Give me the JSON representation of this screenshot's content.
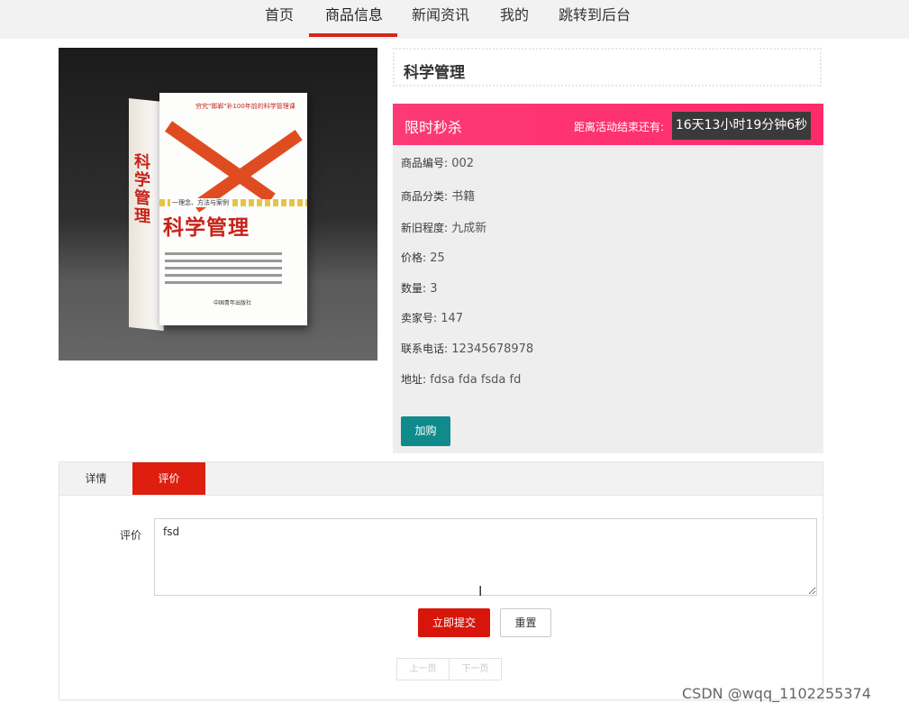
{
  "nav": {
    "items": [
      {
        "label": "首页"
      },
      {
        "label": "商品信息"
      },
      {
        "label": "新闻资讯"
      },
      {
        "label": "我的"
      },
      {
        "label": "跳转到后台"
      }
    ]
  },
  "product": {
    "image": {
      "cover_title": "科学管理",
      "cover_subtitle": "一理念、方法与案例",
      "cover_tagline": "穷究\"邯郸\"补100年前的科学管理课",
      "cover_publisher": "中国青年出版社"
    },
    "title": "科学管理",
    "flash_sale": {
      "label": "限时秒杀",
      "countdown_label": "距离活动结束还有:",
      "countdown": "16天13小时19分钟6秒"
    },
    "info": [
      {
        "key": "商品编号:",
        "value": "002"
      },
      {
        "key": "商品分类:",
        "value": "书籍"
      },
      {
        "key": "新旧程度:",
        "value": "九成新"
      },
      {
        "key": "价格:",
        "value": "25"
      },
      {
        "key": "数量:",
        "value": "3"
      },
      {
        "key": "卖家号:",
        "value": "147"
      },
      {
        "key": "联系电话:",
        "value": "12345678978"
      },
      {
        "key": "地址:",
        "value": "fdsa fda fsda fd"
      }
    ],
    "add_cart_label": "加购"
  },
  "tabs": [
    {
      "label": "详情"
    },
    {
      "label": "评价"
    }
  ],
  "review_form": {
    "label": "评价",
    "value": "fsd",
    "submit_label": "立即提交",
    "reset_label": "重置"
  },
  "pager": {
    "prev_label": "上一页",
    "next_label": "下一页"
  },
  "watermark": "CSDN @wqq_1102255374",
  "colors": {
    "accent_red": "#de1f10",
    "sale_pink": "#fc3a75",
    "add_cart_teal": "#108a8b"
  }
}
